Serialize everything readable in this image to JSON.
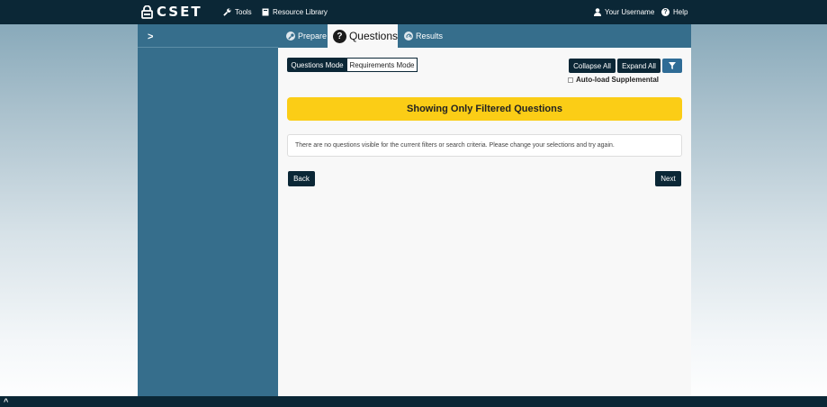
{
  "app": {
    "logo_text": "CSET",
    "colors": {
      "navbar": "#0b2736",
      "sidebar": "#366e8c",
      "banner": "#fbcd16",
      "content": "#f8f8f8"
    }
  },
  "topnav": {
    "tools_label": "Tools",
    "resource_library_label": "Resource Library",
    "username_label": "Your Username",
    "help_label": "Help"
  },
  "tabs": [
    {
      "label": "Prepare",
      "icon": "wrench-icon",
      "active": false
    },
    {
      "label": "Questions",
      "icon": "question-icon",
      "active": true
    },
    {
      "label": "Results",
      "icon": "gauge-icon",
      "active": false
    }
  ],
  "toolbar": {
    "questions_mode_label": "Questions Mode",
    "requirements_mode_label": "Requirements Mode",
    "collapse_all_label": "Collapse All",
    "expand_all_label": "Expand All",
    "filter_icon": "filter-icon",
    "auto_load_label": "Auto-load Supplemental"
  },
  "banner": {
    "text": "Showing Only Filtered Questions"
  },
  "notice": {
    "text": "There are no questions visible for the current filters or search criteria. Please change your selections and try again."
  },
  "pager": {
    "back_label": "Back",
    "next_label": "Next"
  }
}
